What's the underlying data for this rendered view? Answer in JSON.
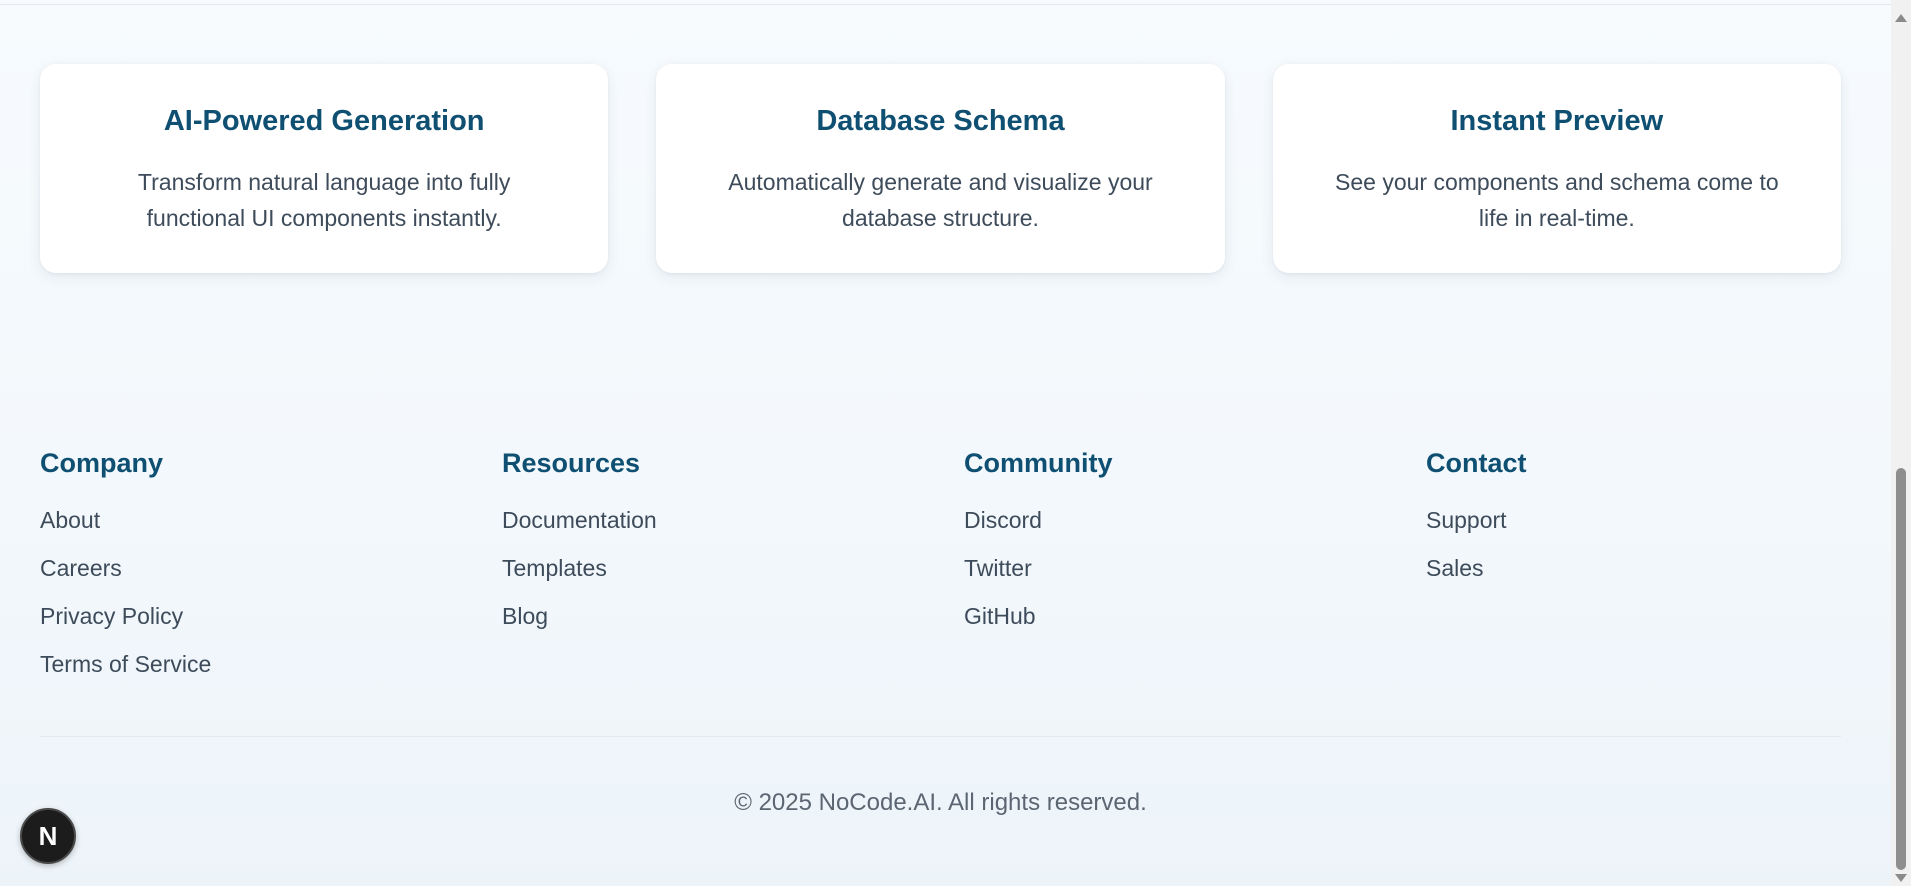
{
  "features": [
    {
      "title": "AI-Powered Generation",
      "line1": "Transform natural language into fully",
      "line2": "functional UI components instantly."
    },
    {
      "title": "Database Schema",
      "line1": "Automatically generate and visualize your",
      "line2": "database structure."
    },
    {
      "title": "Instant Preview",
      "line1": "See your components and schema come to",
      "line2": "life in real-time."
    }
  ],
  "footer": {
    "columns": [
      {
        "heading": "Company",
        "links": [
          "About",
          "Careers",
          "Privacy Policy",
          "Terms of Service"
        ]
      },
      {
        "heading": "Resources",
        "links": [
          "Documentation",
          "Templates",
          "Blog"
        ]
      },
      {
        "heading": "Community",
        "links": [
          "Discord",
          "Twitter",
          "GitHub"
        ]
      },
      {
        "heading": "Contact",
        "links": [
          "Support",
          "Sales"
        ]
      }
    ],
    "copyright": "© 2025 NoCode.AI. All rights reserved."
  },
  "badge": {
    "letter": "N",
    "icon": "nextjs-icon"
  },
  "colors": {
    "heading": "#0e4f72",
    "body_text": "#3d4b5a",
    "muted_text": "#5b6672",
    "card_bg": "#ffffff",
    "page_bg": "#f5f9fd"
  }
}
